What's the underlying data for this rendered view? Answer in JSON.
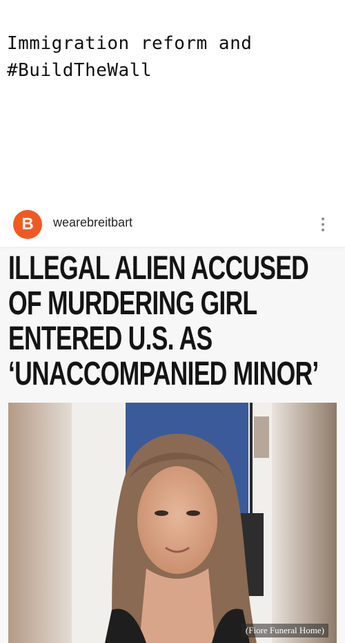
{
  "caption": "Immigration reform and\n#BuildTheWall",
  "post": {
    "avatar_letter": "B",
    "username": "wearebreitbart",
    "more_icon": "more-vertical-icon",
    "headline": "ILLEGAL ALIEN ACCUSED OF MURDERING GIRL ENTERED U.S. AS ‘UNACCOMPANIED MINOR’",
    "photo_credit": "(Fiore Funeral Home)"
  },
  "colors": {
    "brand_orange": "#f05a22",
    "headline_text": "#141414"
  }
}
